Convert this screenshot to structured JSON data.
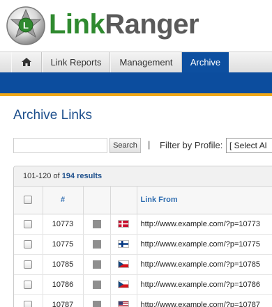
{
  "app": {
    "logo_part1": "Link",
    "logo_part2": "Ranger"
  },
  "nav": {
    "home_icon": "home-icon",
    "items": [
      {
        "label": "Link Reports"
      },
      {
        "label": "Management"
      },
      {
        "label": "Archive",
        "active": true
      }
    ]
  },
  "page": {
    "title": "Archive Links"
  },
  "search": {
    "input_value": "",
    "button_label": "Search"
  },
  "filter": {
    "separator": "|",
    "label": "Filter by Profile:",
    "selected": "[ Select Al"
  },
  "results": {
    "range": "101-120",
    "of_text": "of",
    "count_text": "194 results"
  },
  "table": {
    "headers": {
      "number": "#",
      "link_from": "Link From"
    },
    "rows": [
      {
        "id": "10773",
        "flag": "denmark-flag-icon",
        "url": "http://www.example.com/?p=10773"
      },
      {
        "id": "10775",
        "flag": "finland-flag-icon",
        "url": "http://www.example.com/?p=10775"
      },
      {
        "id": "10785",
        "flag": "czech-flag-icon",
        "url": "http://www.example.com/?p=10785"
      },
      {
        "id": "10786",
        "flag": "czech-flag-icon",
        "url": "http://www.example.com/?p=10786"
      },
      {
        "id": "10787",
        "flag": "usa-flag-icon",
        "url": "http://www.example.com/?p=10787"
      }
    ]
  },
  "colors": {
    "brand_green": "#2f8a2f",
    "nav_blue": "#0d4fa0",
    "accent_gold": "#f0a818",
    "title_blue": "#1d4f8c"
  }
}
